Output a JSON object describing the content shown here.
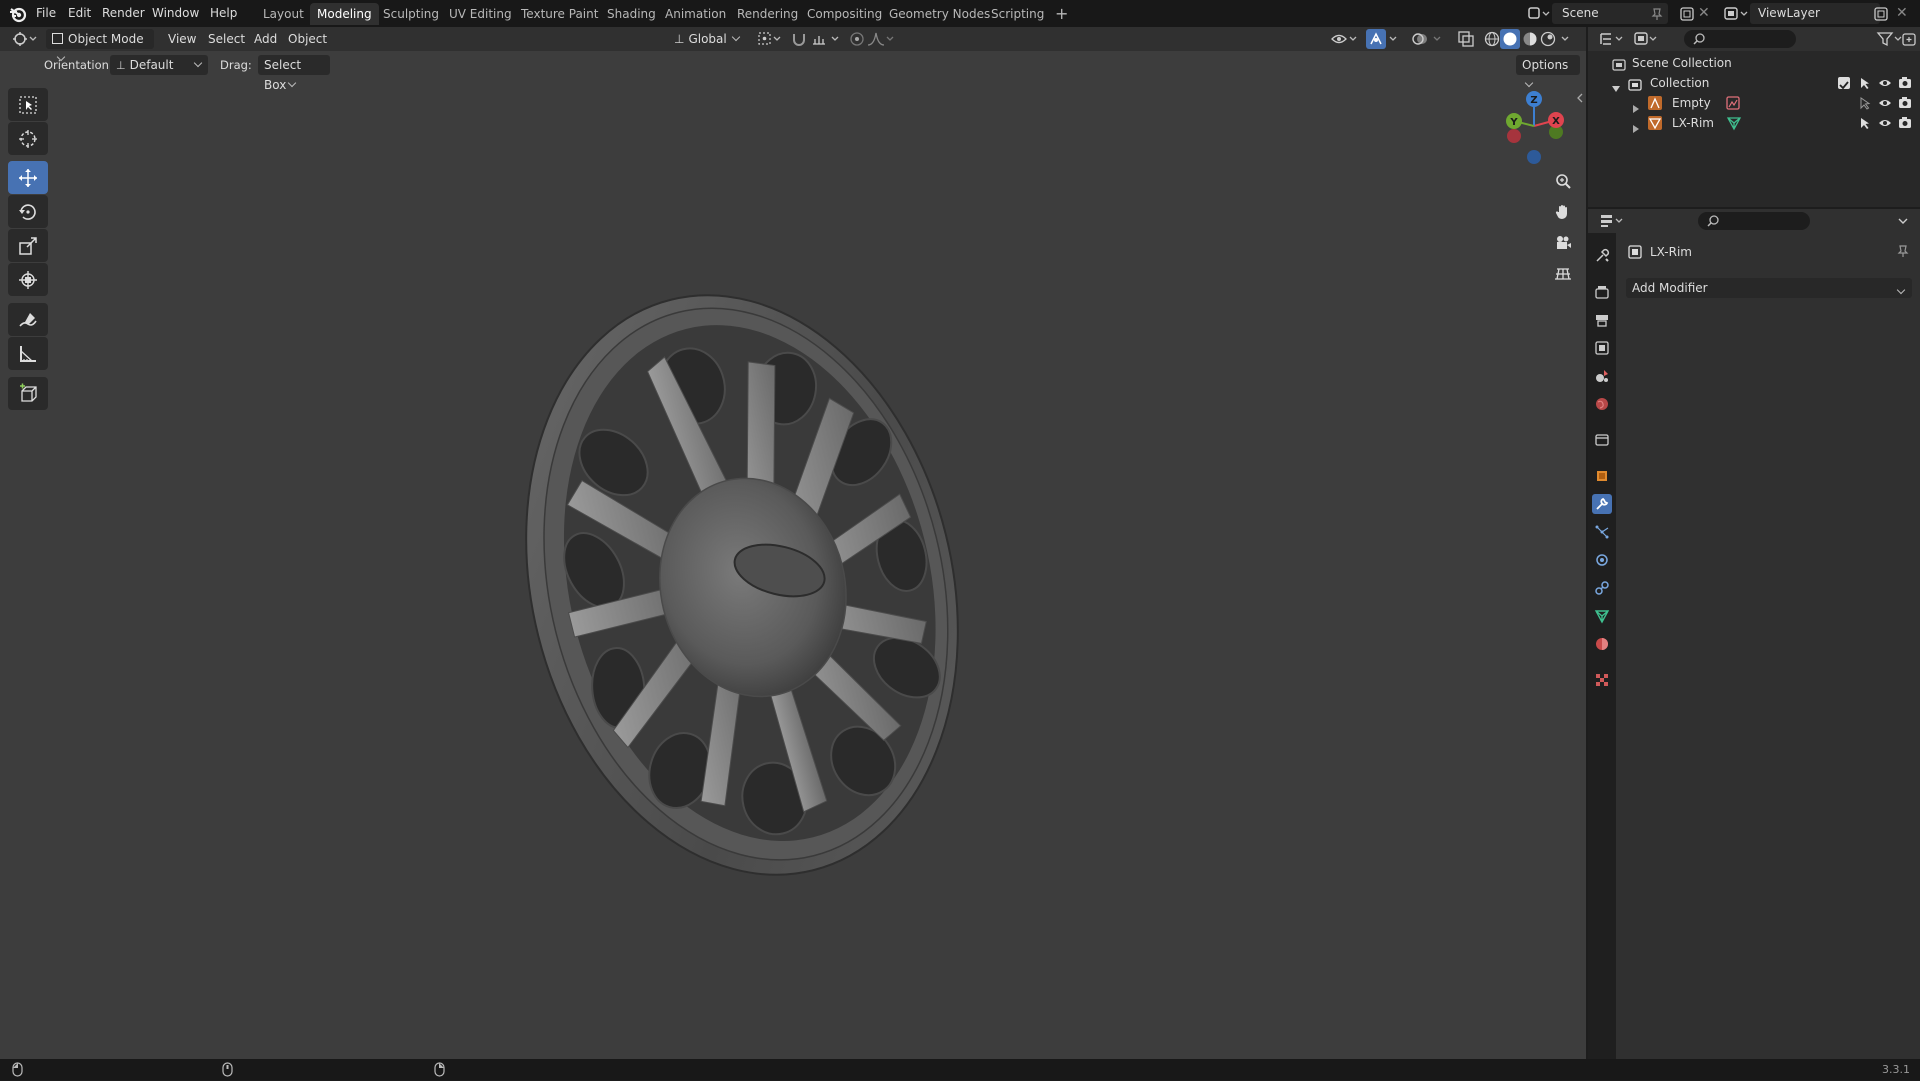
{
  "menu": {
    "file": "File",
    "edit": "Edit",
    "render": "Render",
    "window": "Window",
    "help": "Help"
  },
  "workspaces": [
    "Layout",
    "Modeling",
    "Sculpting",
    "UV Editing",
    "Texture Paint",
    "Shading",
    "Animation",
    "Rendering",
    "Compositing",
    "Geometry Nodes",
    "Scripting"
  ],
  "active_workspace": "Modeling",
  "scene": {
    "name": "Scene"
  },
  "view_layer": {
    "name": "ViewLayer"
  },
  "viewport_header": {
    "mode": "Object Mode",
    "view": "View",
    "select": "Select",
    "add": "Add",
    "object": "Object",
    "transform_orientation": "Global"
  },
  "tool_settings": {
    "orientation_label": "Orientation:",
    "orientation_value": "Default",
    "drag_label": "Drag:",
    "drag_value": "Select Box",
    "options": "Options"
  },
  "gizmo": {
    "x": "X",
    "y": "Y",
    "z": "Z"
  },
  "outliner": {
    "scene_collection": "Scene Collection",
    "collection": "Collection",
    "items": [
      {
        "name": "Empty"
      },
      {
        "name": "LX-Rim"
      }
    ]
  },
  "properties": {
    "object_name": "LX-Rim",
    "add_modifier": "Add Modifier"
  },
  "status": {
    "version": "3.3.1"
  },
  "colors": {
    "accent": "#4772b3",
    "viewport_bg": "#3d3d3d",
    "header_bg": "#303030",
    "axis_x": "#e0444f",
    "axis_y": "#6fa830",
    "axis_z": "#3d7fd1"
  }
}
